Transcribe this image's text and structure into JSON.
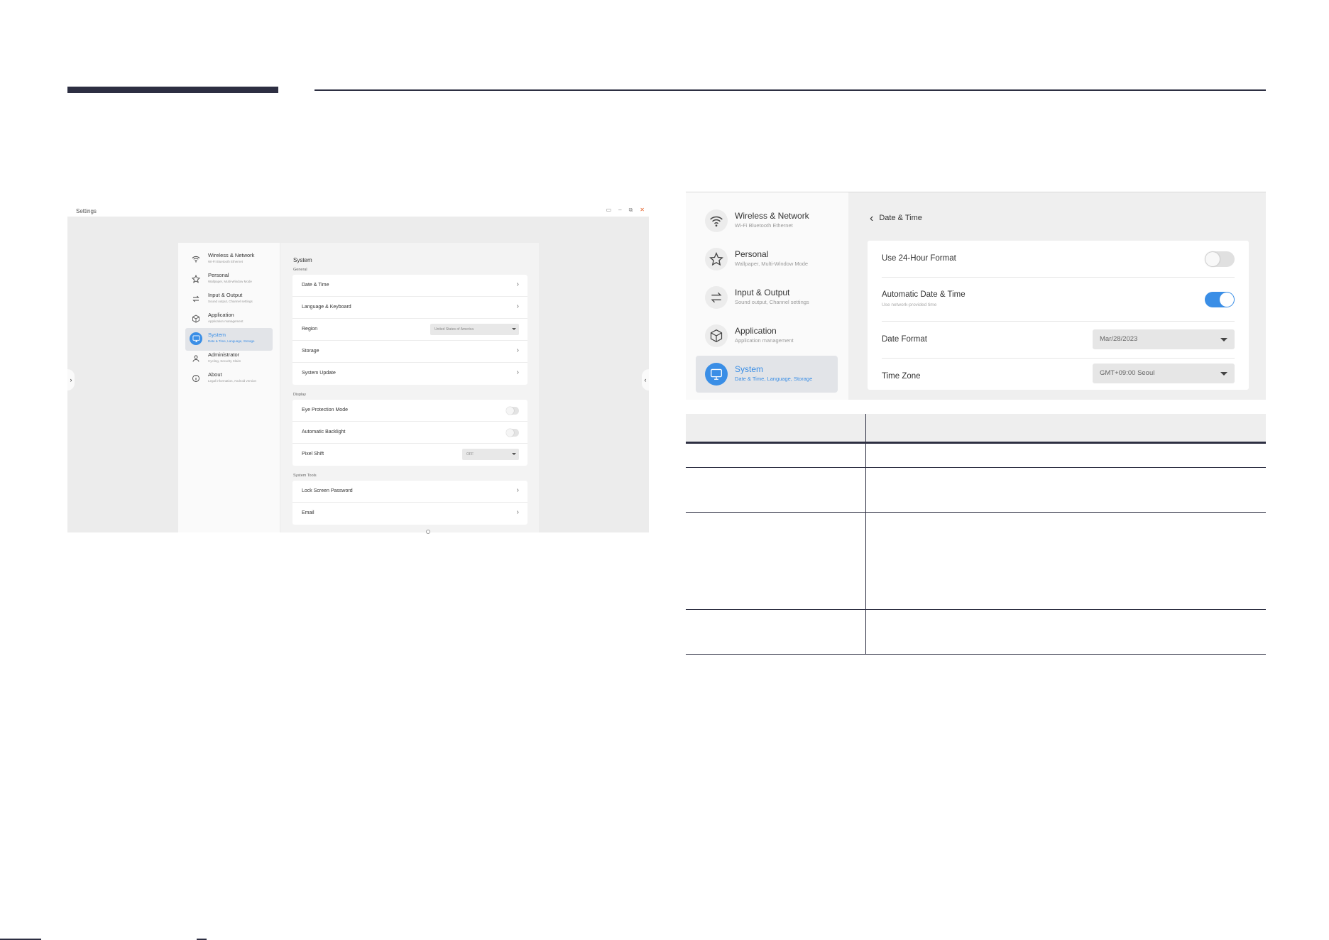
{
  "colors": {
    "accent": "#3a8ee6",
    "header_rule": "#2d2f42",
    "close": "#e5622a"
  },
  "left_window": {
    "title": "Settings",
    "nav": [
      {
        "icon": "wifi-icon",
        "label": "Wireless & Network",
        "sub": "Wi-Fi Bluetooth Ethernet"
      },
      {
        "icon": "star-icon",
        "label": "Personal",
        "sub": "Wallpaper, Multi-Window Mode"
      },
      {
        "icon": "swap-arrows-icon",
        "label": "Input & Output",
        "sub": "Sound output, Channel settings"
      },
      {
        "icon": "cube-icon",
        "label": "Application",
        "sub": "Application management"
      },
      {
        "icon": "monitor-icon",
        "label": "System",
        "sub": "Date & Time, Language, Storage",
        "active": true
      },
      {
        "icon": "person-icon",
        "label": "Administrator",
        "sub": "Cycling, Security Claim"
      },
      {
        "icon": "info-icon",
        "label": "About",
        "sub": "Legal information, Android version"
      }
    ],
    "main": {
      "title": "System",
      "sections": {
        "general": "General",
        "display": "Display",
        "tools": "System Tools"
      },
      "general_rows": [
        "Date & Time",
        "Language & Keyboard",
        "Region",
        "Storage",
        "System Update"
      ],
      "region_value": "United States of America",
      "display_rows": [
        "Eye Protection Mode",
        "Automatic Backlight",
        "Pixel Shift"
      ],
      "pixel_shift_value": "OFF",
      "tools_rows": [
        "Lock Screen Password",
        "Email"
      ]
    }
  },
  "right_window": {
    "nav": [
      {
        "icon": "wifi-icon",
        "label": "Wireless & Network",
        "sub": "Wi-Fi Bluetooth Ethernet"
      },
      {
        "icon": "star-icon",
        "label": "Personal",
        "sub": "Wallpaper, Multi-Window Mode"
      },
      {
        "icon": "swap-arrows-icon",
        "label": "Input & Output",
        "sub": "Sound output, Channel settings"
      },
      {
        "icon": "cube-icon",
        "label": "Application",
        "sub": "Application management"
      },
      {
        "icon": "monitor-icon",
        "label": "System",
        "sub": "Date & Time, Language, Storage",
        "active": true
      }
    ],
    "back_label": "Date & Time",
    "rows": {
      "hour24": {
        "label": "Use 24-Hour Format",
        "on": false
      },
      "auto": {
        "label": "Automatic Date & Time",
        "sub": "Use network-provided time",
        "on": true
      },
      "date_format": {
        "label": "Date Format",
        "value": "Mar/28/2023"
      },
      "time_zone": {
        "label": "Time Zone",
        "value": "GMT+09:00 Seoul"
      }
    }
  }
}
